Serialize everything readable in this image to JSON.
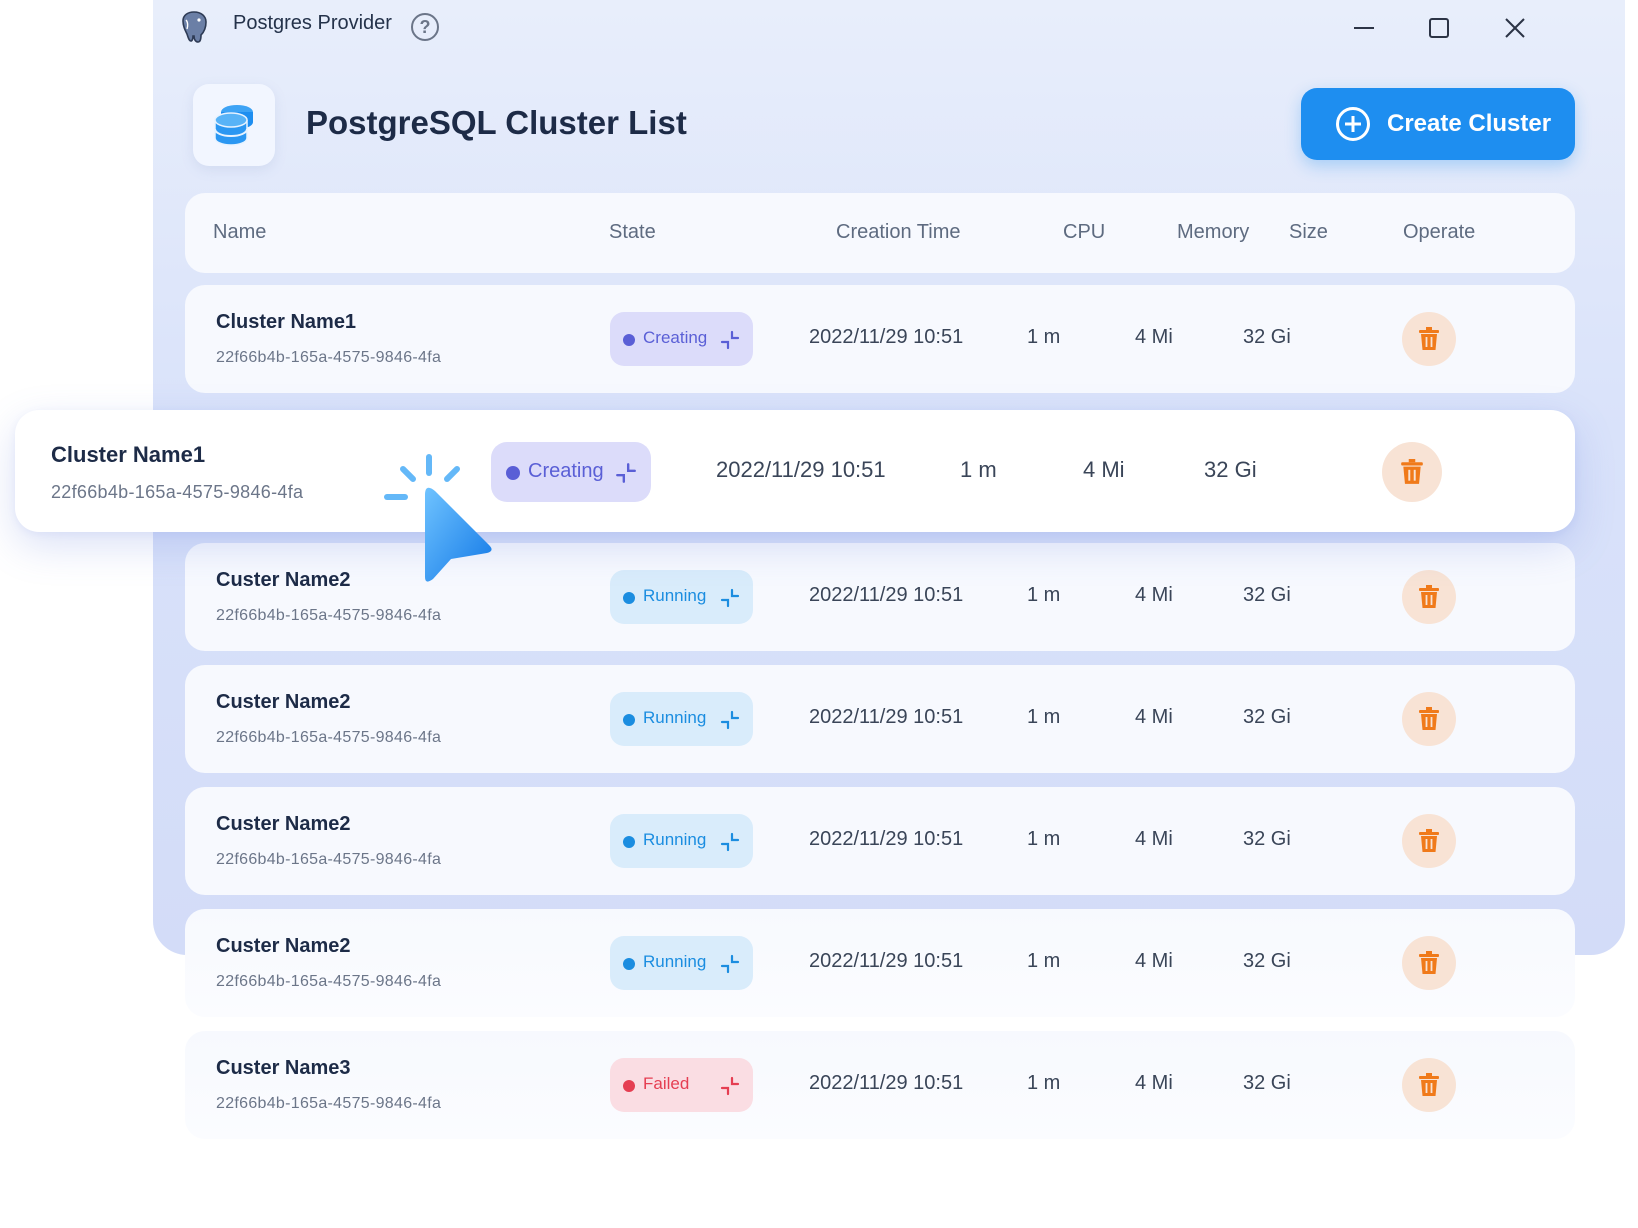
{
  "window": {
    "app_title": "Postgres Provider",
    "help_icon": "question-circle-icon",
    "controls": [
      "minimize-icon",
      "maximize-icon",
      "close-icon"
    ]
  },
  "header": {
    "title": "PostgreSQL Cluster List",
    "icon": "database-icon",
    "create_button": {
      "label": "Create Cluster",
      "icon": "plus-circle-icon"
    }
  },
  "table": {
    "columns": [
      "Name",
      "State",
      "Creation Time",
      "CPU",
      "Memory",
      "Size",
      "Operate"
    ],
    "rows": [
      {
        "name": "Cluster Name1",
        "id": "22f66b4b-165a-4575-9846-4fa",
        "state": "Creating",
        "created": "2022/11/29 10:51",
        "cpu": "1 m",
        "memory": "4 Mi",
        "size": "32 Gi"
      },
      {
        "name": "Custer Name2",
        "id": "22f66b4b-165a-4575-9846-4fa",
        "state": "Running",
        "created": "2022/11/29 10:51",
        "cpu": "1 m",
        "memory": "4 Mi",
        "size": "32 Gi"
      },
      {
        "name": "Custer Name2",
        "id": "22f66b4b-165a-4575-9846-4fa",
        "state": "Running",
        "created": "2022/11/29 10:51",
        "cpu": "1 m",
        "memory": "4 Mi",
        "size": "32 Gi"
      },
      {
        "name": "Custer Name2",
        "id": "22f66b4b-165a-4575-9846-4fa",
        "state": "Running",
        "created": "2022/11/29 10:51",
        "cpu": "1 m",
        "memory": "4 Mi",
        "size": "32 Gi"
      },
      {
        "name": "Custer Name2",
        "id": "22f66b4b-165a-4575-9846-4fa",
        "state": "Running",
        "created": "2022/11/29 10:51",
        "cpu": "1 m",
        "memory": "4 Mi",
        "size": "32 Gi"
      },
      {
        "name": "Custer Name3",
        "id": "22f66b4b-165a-4575-9846-4fa",
        "state": "Failed",
        "created": "2022/11/29 10:51",
        "cpu": "1 m",
        "memory": "4 Mi",
        "size": "32 Gi"
      }
    ],
    "hovered_row": {
      "name": "Cluster Name1",
      "id": "22f66b4b-165a-4575-9846-4fa",
      "state": "Creating",
      "created": "2022/11/29 10:51",
      "cpu": "1 m",
      "memory": "4 Mi",
      "size": "32 Gi"
    }
  },
  "icons": {
    "state_action": "collapse-arrows-icon",
    "delete": "trash-icon",
    "pointer": "mouse-pointer-icon"
  },
  "colors": {
    "accent": "#1e8ef0",
    "creating": "#5a5fd6",
    "running": "#1b8de0",
    "failed": "#e53e52",
    "delete": "#f07a1a"
  }
}
